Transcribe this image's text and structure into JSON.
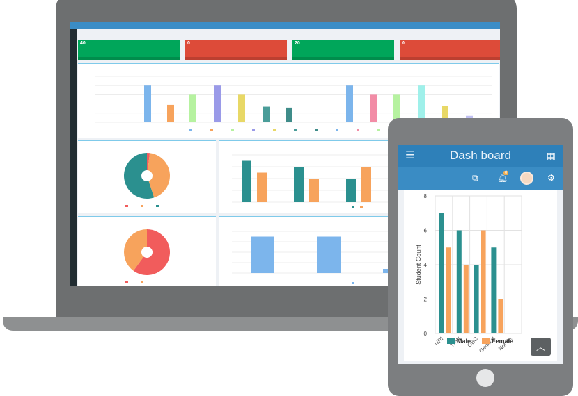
{
  "laptop": {
    "stat_cards": [
      {
        "value": "40",
        "color": "#00a65a"
      },
      {
        "value": "0",
        "color": "#dd4b39"
      },
      {
        "value": "20",
        "color": "#00a65a"
      },
      {
        "value": "0",
        "color": "#dd4b39"
      }
    ]
  },
  "tablet": {
    "header": {
      "title": "Dash board",
      "menu_icon": "hamburger-icon",
      "apps_icon": "grid-icon"
    },
    "toolbar": {
      "notification_count": "0",
      "icons": [
        "translate-icon",
        "bell-icon",
        "avatar",
        "settings-icon"
      ]
    },
    "scroll_top_icon": "chevron-up-icon"
  },
  "chart_data": [
    {
      "type": "bar",
      "location": "laptop-top",
      "values": [
        20,
        9.5,
        15,
        20,
        15,
        8.5,
        8,
        20,
        15,
        15,
        20,
        9,
        3.5
      ],
      "colors": [
        "#7cb5ec",
        "#f7a35c",
        "#b6f2a0",
        "#9a9ae8",
        "#e8d866",
        "#4a9d99",
        "#3f8c89",
        "#7cb5ec",
        "#f28ca6",
        "#b6f2a0",
        "#9ff0ea",
        "#e8d866",
        "#c0c0f2"
      ],
      "ylim": [
        0,
        25
      ],
      "grid": true
    },
    {
      "type": "pie",
      "location": "laptop-student",
      "values": [
        2,
        43,
        55
      ],
      "colors": [
        "#f15c5c",
        "#f7a35c",
        "#2b908f"
      ]
    },
    {
      "type": "bar",
      "location": "laptop-category",
      "series": [
        {
          "values": [
            7,
            6,
            4
          ],
          "color": "#2b908f"
        },
        {
          "values": [
            5,
            4,
            6
          ],
          "color": "#f7a35c"
        }
      ],
      "ylim": [
        0,
        8
      ],
      "grid": true
    },
    {
      "type": "pie",
      "location": "laptop-employee",
      "values": [
        60,
        40
      ],
      "colors": [
        "#f15c5c",
        "#f7a35c"
      ]
    },
    {
      "type": "bar",
      "location": "laptop-joining",
      "values": [
        3.5,
        3.5,
        0.4
      ],
      "colors": [
        "#7cb5ec"
      ],
      "ylim": [
        0,
        4
      ],
      "grid": true
    },
    {
      "type": "bar",
      "location": "tablet",
      "ylabel": "Student Count",
      "categories": [
        "NRI",
        "TFW",
        "OBC",
        "General",
        "Not Se"
      ],
      "series": [
        {
          "name": "Male",
          "values": [
            7,
            6,
            4,
            5,
            0
          ],
          "color": "#2b908f"
        },
        {
          "name": "Female",
          "values": [
            5,
            4,
            6,
            2,
            0
          ],
          "color": "#f7a35c"
        }
      ],
      "yticks": [
        "0",
        "2",
        "4",
        "6",
        "8"
      ],
      "ylim": [
        0,
        8
      ],
      "grid": true,
      "legend": "bottom"
    }
  ]
}
